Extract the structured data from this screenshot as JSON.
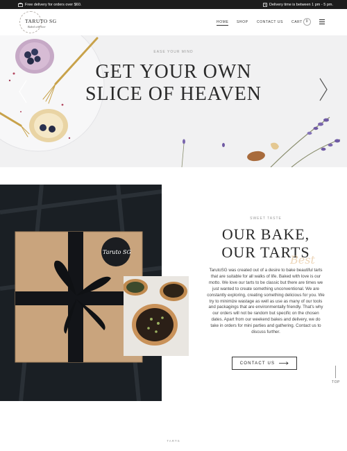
{
  "topbar": {
    "left_text": "Free delivery for orders over $60.",
    "right_text": "Delivery time is between 1 pm - 5 pm."
  },
  "header": {
    "logo_name": "TARUTO SG",
    "logo_tagline": "Baked with love",
    "nav": {
      "home": "HOME",
      "shop": "SHOP",
      "contact": "CONTACT US",
      "cart": "CART",
      "cart_count": "0"
    }
  },
  "hero": {
    "eyebrow": "EASE YOUR MIND",
    "headline_line1": "GET YOUR OWN",
    "headline_line2": "SLICE OF HEAVEN"
  },
  "about": {
    "box_label": "Taruto SG",
    "eyebrow": "SWEET TASTE",
    "heading_line1": "OUR BAKE,",
    "heading_line2": "OUR TARTS",
    "script_word": "Best",
    "body": "TarutoSG was created out of a desire to bake beautiful tarts that are suitable for all walks of life. Baked with love is our motto. We love our tarts to be classic but there are times we just wanted to create something unconventional. We are constantly exploring, creating something delicious for you. We try to minimize wastage as well as use as many of our tools and packagings that are environmentally friendly. That's why our orders will not be random but specific on the chosen dates. Apart from our weekend bakes and delivery, we do take in orders for mini parties and gathering. Contact us to discuss further.",
    "button_label": "CONTACT US",
    "top_label": "TOP"
  },
  "next_section": {
    "eyebrow": "TARTS"
  }
}
